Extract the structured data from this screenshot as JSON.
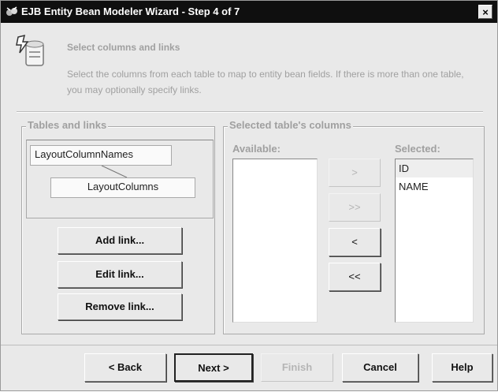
{
  "window": {
    "title": "EJB Entity Bean Modeler Wizard - Step 4 of 7",
    "close_label": "×"
  },
  "header": {
    "title": "Select columns and links",
    "description": "Select the columns from each table to map to entity bean fields.  If there is more than one table, you may optionally specify links."
  },
  "tables_links": {
    "group_label": "Tables and links",
    "tables": [
      "LayoutColumnNames",
      "LayoutColumns"
    ],
    "buttons": {
      "add": "Add link...",
      "edit": "Edit link...",
      "remove": "Remove link..."
    }
  },
  "columns": {
    "group_label": "Selected table's columns",
    "available_label": "Available:",
    "selected_label": "Selected:",
    "available": [],
    "selected": [
      "ID",
      "NAME"
    ],
    "move_buttons": {
      "add_one": ">",
      "add_all": ">>",
      "remove_one": "<",
      "remove_all": "<<"
    }
  },
  "nav": {
    "back": "< Back",
    "next": "Next >",
    "finish": "Finish",
    "cancel": "Cancel",
    "help": "Help"
  }
}
